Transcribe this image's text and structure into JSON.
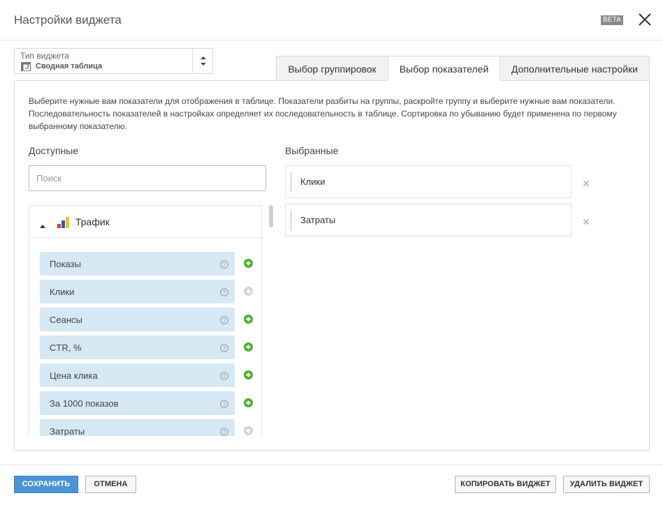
{
  "header": {
    "title": "Настройки виджета",
    "badge": "BETA"
  },
  "widget_type": {
    "label": "Тип виджета",
    "value": "Сводная таблица"
  },
  "tabs": [
    {
      "label": "Выбор группировок",
      "active": false
    },
    {
      "label": "Выбор показателей",
      "active": true
    },
    {
      "label": "Дополнительные настройки",
      "active": false
    }
  ],
  "panel": {
    "description": "Выберите нужные вам показатели для отображения в таблице. Показатели разбиты на группы, раскройте группу и выберите нужные вам показатели. Последовательность показателей в настройках определяет их последовательность в таблице. Сортировка по убыванию будет применена по первому выбранному показателю.",
    "available_heading": "Доступные",
    "selected_heading": "Выбранные",
    "search_placeholder": "Поиск",
    "group": {
      "label": "Трафик",
      "expanded": true,
      "items": [
        {
          "label": "Показы",
          "added": false
        },
        {
          "label": "Клики",
          "added": true
        },
        {
          "label": "Сеансы",
          "added": false
        },
        {
          "label": "CTR, %",
          "added": false
        },
        {
          "label": "Цена клика",
          "added": false
        },
        {
          "label": "За 1000 показов",
          "added": false
        },
        {
          "label": "Затраты",
          "added": true
        }
      ]
    },
    "selected": [
      {
        "label": "Клики"
      },
      {
        "label": "Затраты"
      }
    ]
  },
  "footer": {
    "save": "СОХРАНИТЬ",
    "cancel": "ОТМЕНА",
    "copy": "КОПИРОВАТЬ ВИДЖЕТ",
    "delete": "УДАЛИТЬ ВИДЖЕТ"
  },
  "colors": {
    "accent": "#4a94d6",
    "item_bg": "#d6e8f4",
    "add_active": "#4caf2e",
    "add_disabled": "#cccccc"
  }
}
